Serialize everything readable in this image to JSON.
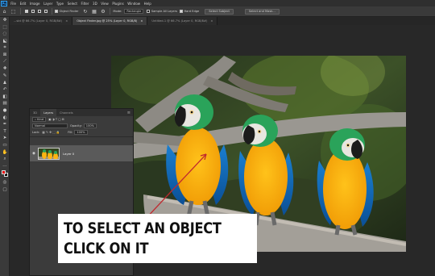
{
  "app": {
    "logo": "Ps"
  },
  "menu": [
    "File",
    "Edit",
    "Image",
    "Layer",
    "Type",
    "Select",
    "Filter",
    "3D",
    "View",
    "Plugins",
    "Window",
    "Help"
  ],
  "options_bar": {
    "object_finder_label": "Object Finder",
    "mode_label": "Mode:",
    "mode_value": "Rectangle",
    "sample_all_layers_label": "Sample All Layers",
    "hard_edge_label": "Hard Edge",
    "select_subject_label": "Select Subject",
    "select_and_mask_label": "Select and Mask..."
  },
  "tabs": [
    {
      "label": "...sbt @ 66.7% (Layer 0, RGB/8#)",
      "active": false
    },
    {
      "label": "Object Finder.jpg @ 25% (Layer 0, RGB/8)",
      "active": true
    },
    {
      "label": "Untitled-1 @ 66.7% (Layer 0, RGB/8#)",
      "active": false
    }
  ],
  "layers_panel": {
    "tab_3d": "3D",
    "tab_layers": "Layers",
    "tab_channels": "Channels",
    "kind_label": "Kind",
    "blend_mode": "Normal",
    "opacity_label": "Opacity:",
    "opacity_value": "100%",
    "lock_label": "Lock:",
    "fill_label": "Fill:",
    "fill_value": "100%",
    "layer_name": "Layer 0"
  },
  "caption": {
    "line1": "TO SELECT AN OBJECT",
    "line2": "CLICK ON IT"
  },
  "colors": {
    "foreground": "#e60000",
    "background": "#0a0a0a",
    "accent": "#31a8ff"
  }
}
